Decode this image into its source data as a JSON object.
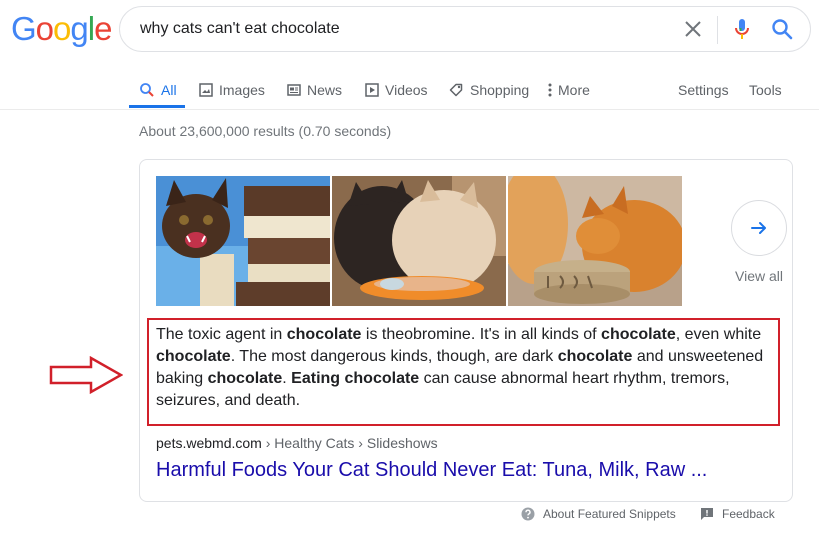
{
  "logo": {
    "text": "Google",
    "letters": [
      "G",
      "o",
      "o",
      "g",
      "l",
      "e"
    ],
    "colors": [
      "#4285F4",
      "#EA4335",
      "#FBBC05",
      "#4285F4",
      "#34A853",
      "#EA4335"
    ]
  },
  "search": {
    "query": "why cats can't eat chocolate",
    "icons": [
      "close-icon",
      "microphone-icon",
      "search-icon"
    ]
  },
  "tabs": [
    {
      "label": "All",
      "icon": "search-icon",
      "active": true
    },
    {
      "label": "Images",
      "icon": "image-icon"
    },
    {
      "label": "News",
      "icon": "news-icon"
    },
    {
      "label": "Videos",
      "icon": "play-icon"
    },
    {
      "label": "Shopping",
      "icon": "tag-icon"
    },
    {
      "label": "More",
      "icon": "more-vert-icon"
    }
  ],
  "tools": {
    "settings": "Settings",
    "tools": "Tools"
  },
  "stats": "About 23,600,000 results (0.70 seconds)",
  "images": [
    {
      "subject": "kitten with chocolate bars"
    },
    {
      "subject": "two cats eating"
    },
    {
      "subject": "orange cat eating from bowl"
    }
  ],
  "view_all": {
    "label": "View all",
    "icon": "arrow-right-icon"
  },
  "snippet": {
    "segments": [
      {
        "text": "The toxic agent in ",
        "bold": false
      },
      {
        "text": "chocolate",
        "bold": true
      },
      {
        "text": " is theobromine. It's in all kinds of ",
        "bold": false
      },
      {
        "text": "chocolate",
        "bold": true
      },
      {
        "text": ", even white ",
        "bold": false
      },
      {
        "text": "chocolate",
        "bold": true
      },
      {
        "text": ". The most dangerous kinds, though, are dark ",
        "bold": false
      },
      {
        "text": "chocolate",
        "bold": true
      },
      {
        "text": " and unsweetened baking ",
        "bold": false
      },
      {
        "text": "chocolate",
        "bold": true
      },
      {
        "text": ". ",
        "bold": false
      },
      {
        "text": "Eating chocolate",
        "bold": true
      },
      {
        "text": " can cause abnormal heart rhythm, tremors, seizures, and death.",
        "bold": false
      }
    ]
  },
  "annotation": {
    "arrow_color": "#d1202a",
    "box_color": "#d1202a"
  },
  "result": {
    "domain": "pets.webmd.com",
    "breadcrumb": " › Healthy Cats › Slideshows",
    "title": "Harmful Foods Your Cat Should Never Eat: Tuna, Milk, Raw ..."
  },
  "footer": {
    "about": "About Featured Snippets",
    "feedback": "Feedback"
  },
  "colors": {
    "link": "#1a0dab",
    "accent": "#1a73e8",
    "muted": "#70757a"
  }
}
